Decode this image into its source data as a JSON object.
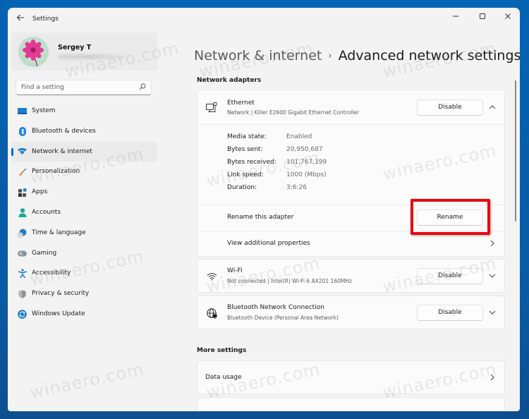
{
  "window": {
    "app_title": "Settings",
    "controls": {
      "minimize": "—",
      "maximize": "☐",
      "close": "✕"
    }
  },
  "profile": {
    "name": "Sergey T"
  },
  "search": {
    "placeholder": "Find a setting"
  },
  "sidebar": {
    "items": [
      {
        "label": "System",
        "icon": "system-icon",
        "active": false
      },
      {
        "label": "Bluetooth & devices",
        "icon": "bluetooth-icon",
        "active": false
      },
      {
        "label": "Network & internet",
        "icon": "wifi-icon",
        "active": true
      },
      {
        "label": "Personalization",
        "icon": "brush-icon",
        "active": false
      },
      {
        "label": "Apps",
        "icon": "apps-icon",
        "active": false
      },
      {
        "label": "Accounts",
        "icon": "person-icon",
        "active": false
      },
      {
        "label": "Time & language",
        "icon": "clock-globe-icon",
        "active": false
      },
      {
        "label": "Gaming",
        "icon": "gamepad-icon",
        "active": false
      },
      {
        "label": "Accessibility",
        "icon": "accessibility-icon",
        "active": false
      },
      {
        "label": "Privacy & security",
        "icon": "shield-icon",
        "active": false
      },
      {
        "label": "Windows Update",
        "icon": "update-icon",
        "active": false
      }
    ]
  },
  "breadcrumb": {
    "parent": "Network & internet",
    "separator": "›",
    "current": "Advanced network settings"
  },
  "network_adapters": {
    "title": "Network adapters",
    "ethernet": {
      "name": "Ethernet",
      "description": "Network | Killer E2600 Gigabit Ethernet Controller",
      "button": "Disable",
      "expanded": true,
      "properties": [
        {
          "label": "Media state:",
          "value": "Enabled"
        },
        {
          "label": "Bytes sent:",
          "value": "20,950,687"
        },
        {
          "label": "Bytes received:",
          "value": "101,767,199"
        },
        {
          "label": "Link speed:",
          "value": "1000 (Mbps)"
        },
        {
          "label": "Duration:",
          "value": "3:6:26"
        }
      ],
      "rename_label": "Rename this adapter",
      "rename_button": "Rename",
      "view_props_label": "View additional properties"
    },
    "wifi": {
      "name": "Wi-Fi",
      "description": "Not connected | Intel(R) Wi-Fi 6 AX201 160MHz",
      "button": "Disable"
    },
    "bluetooth": {
      "name": "Bluetooth Network Connection",
      "description": "Bluetooth Device (Personal Area Network)",
      "button": "Disable"
    }
  },
  "more_settings": {
    "title": "More settings",
    "items": [
      {
        "label": "Data usage"
      }
    ]
  },
  "watermark": "winaero.com",
  "colors": {
    "accent": "#0067c0",
    "highlight_box": "#e8080f",
    "desktop": "#0563b4"
  }
}
